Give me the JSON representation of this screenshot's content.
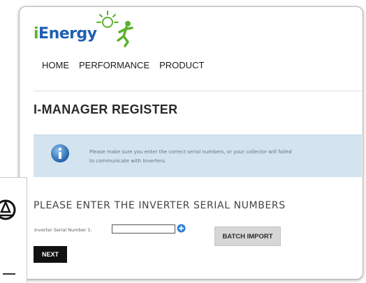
{
  "logo": {
    "text_i": "i",
    "text_rest": "Energy"
  },
  "nav": {
    "items": [
      "HOME",
      "PERFORMANCE",
      "PRODUCT"
    ]
  },
  "page_title": "I-MANAGER REGISTER",
  "notice": {
    "icon": "info-icon",
    "line1": "Please make sure you enter the correct serial numbers, or your collector will failed",
    "line2": "to communicate with Inverters."
  },
  "form": {
    "section_title": "PLEASE ENTER THE INVERTER SERIAL NUMBERS",
    "serial_label": "Inverter Serial Number 1:",
    "serial_value": "",
    "add_icon": "plus-circle-icon",
    "batch_import_label": "BATCH IMPORT",
    "next_label": "NEXT"
  },
  "colors": {
    "logo_blue": "#1e5fb3",
    "logo_green": "#5db12e",
    "notice_bg": "#d3e3ef",
    "next_bg": "#111111",
    "batch_bg": "#d6d6d6"
  }
}
